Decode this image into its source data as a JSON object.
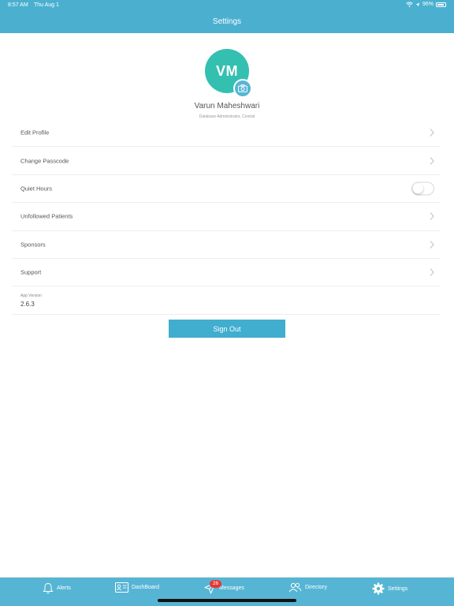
{
  "status": {
    "time": "8:57 AM",
    "date": "Thu Aug 1",
    "battery": "96%"
  },
  "nav": {
    "title": "Settings"
  },
  "profile": {
    "initials": "VM",
    "name": "Varun Maheshwari",
    "role": "Database Administrator, Central"
  },
  "menu": {
    "items": [
      {
        "label": "Edit Profile",
        "control": "chevron"
      },
      {
        "label": "Change Passcode",
        "control": "chevron"
      },
      {
        "label": "Quiet Hours",
        "control": "toggle",
        "toggle_on": false
      },
      {
        "label": "Unfollowed Patients",
        "control": "chevron"
      },
      {
        "label": "Sponsors",
        "control": "chevron"
      },
      {
        "label": "Support",
        "control": "chevron"
      }
    ]
  },
  "version": {
    "label": "App Version",
    "value": "2.6.3"
  },
  "signout": {
    "label": "Sign Out"
  },
  "tabs": {
    "alerts": "Alerts",
    "dashboard": "DashBoard",
    "messages": "Messages",
    "messages_badge": "26",
    "directory": "Directory",
    "settings": "Settings"
  },
  "colors": {
    "header": "#4bb0d0",
    "avatar": "#33c0b0",
    "button": "#41aecf",
    "tabbar": "#56b5d4",
    "badge": "#e53935"
  }
}
